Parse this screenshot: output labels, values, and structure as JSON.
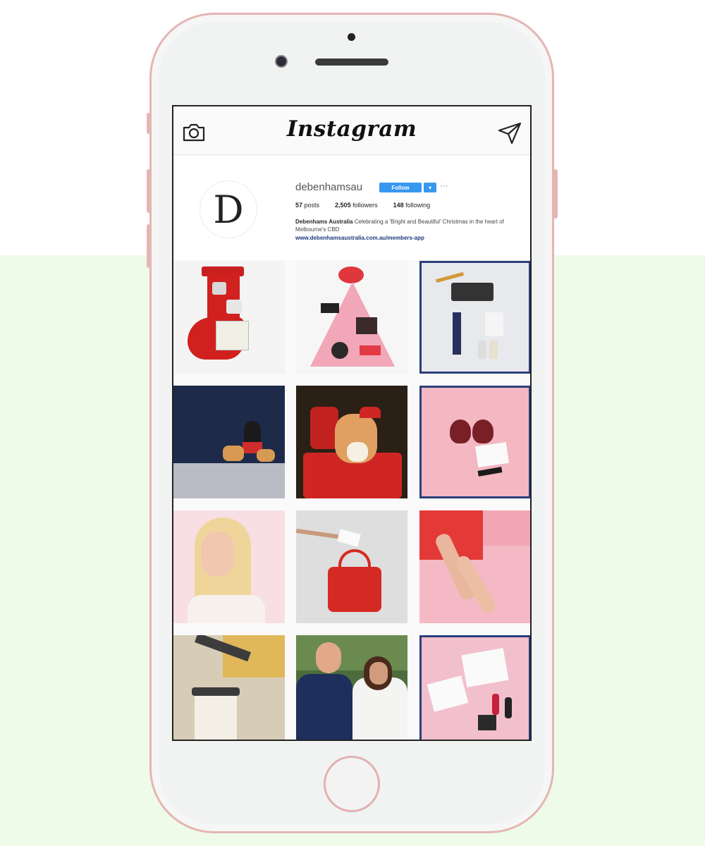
{
  "app": {
    "title": "Instagram"
  },
  "profile": {
    "username": "debenhamsau",
    "follow_label": "Follow",
    "dropdown_label": "▾",
    "more_label": "···",
    "avatar_letter": "D",
    "stats": {
      "posts": "57",
      "posts_label": "posts",
      "followers": "2,505",
      "followers_label": "followers",
      "following": "148",
      "following_label": "following"
    },
    "bio_name": "Debenhams Australia",
    "bio_text": "Celebrating a 'Bright and Beautiful' Christmas in the heart of Melbourne's CBD",
    "bio_link": "www.debenhamsaustralia.com.au/members-app"
  },
  "posts": [
    {
      "subject": "christmas-stocking-skincare"
    },
    {
      "subject": "makeup-christmas-tree"
    },
    {
      "subject": "menswear-flatlay"
    },
    {
      "subject": "event-stage-with-dogs"
    },
    {
      "subject": "corgi-on-red-chair"
    },
    {
      "subject": "lingerie-gift-flatlay"
    },
    {
      "subject": "blonde-woman-portrait"
    },
    {
      "subject": "red-handbag"
    },
    {
      "subject": "legs-on-pink-paper"
    },
    {
      "subject": "coffee-cup-gold"
    },
    {
      "subject": "royal-couple-engagement"
    },
    {
      "subject": "shopping-bag-flatlay"
    }
  ],
  "colors": {
    "phone_frame": "#e3b6b3",
    "follow_blue": "#3897f0",
    "background_green": "#eefbe8"
  }
}
